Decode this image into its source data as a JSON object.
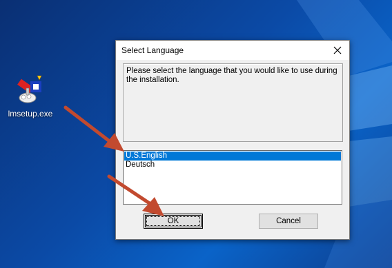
{
  "desktop": {
    "icon_label": "lmsetup.exe",
    "icon_name": "installer-exe-icon"
  },
  "dialog": {
    "title": "Select Language",
    "prompt": "Please select the language that you would like to use during the installation.",
    "languages": [
      "U.S.English",
      "Deutsch"
    ],
    "selected_index": 0,
    "ok_label": "OK",
    "cancel_label": "Cancel"
  },
  "colors": {
    "selection": "#0078d7",
    "arrow": "#c24a2f",
    "desktop_bg": "#0b4aa6"
  }
}
